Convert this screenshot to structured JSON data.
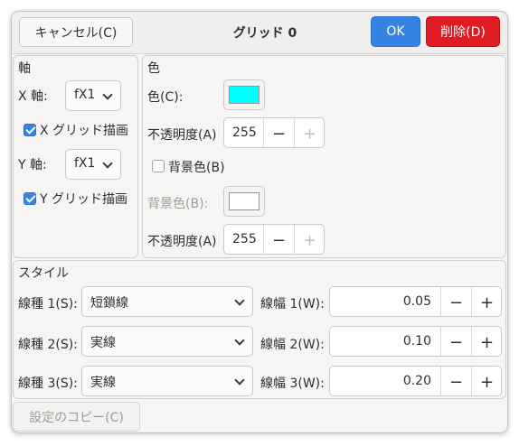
{
  "header": {
    "cancel_label": "キャンセル(C)",
    "title": "グリッド 0",
    "ok_label": "OK",
    "delete_label": "削除(D)"
  },
  "axis": {
    "heading": "軸",
    "x_label": "X 軸:",
    "x_value": "fX1",
    "x_grid_label": "X グリッド描画",
    "x_grid_checked": true,
    "y_label": "Y 軸:",
    "y_value": "fX1",
    "y_grid_label": "Y グリッド描画",
    "y_grid_checked": true
  },
  "color": {
    "heading": "色",
    "color_label": "色(C):",
    "color_value": "#00ffff",
    "opacity_label": "不透明度(A)",
    "opacity_value": "255",
    "bg_checkbox_label": "背景色(B)",
    "bg_checked": false,
    "bg_label": "背景色(B):",
    "bg_value": "#ffffff",
    "bg_opacity_label": "不透明度(A)",
    "bg_opacity_value": "255"
  },
  "style": {
    "heading": "スタイル",
    "rows": [
      {
        "type_label": "線種 1(S):",
        "type_value": "短鎖線",
        "width_label": "線幅 1(W):",
        "width_value": "0.05"
      },
      {
        "type_label": "線種 2(S):",
        "type_value": "実線",
        "width_label": "線幅 2(W):",
        "width_value": "0.10"
      },
      {
        "type_label": "線種 3(S):",
        "type_value": "実線",
        "width_label": "線幅 3(W):",
        "width_value": "0.20"
      }
    ]
  },
  "footer": {
    "copy_label": "設定のコピー(C)"
  },
  "symbols": {
    "minus": "−",
    "plus": "+"
  }
}
